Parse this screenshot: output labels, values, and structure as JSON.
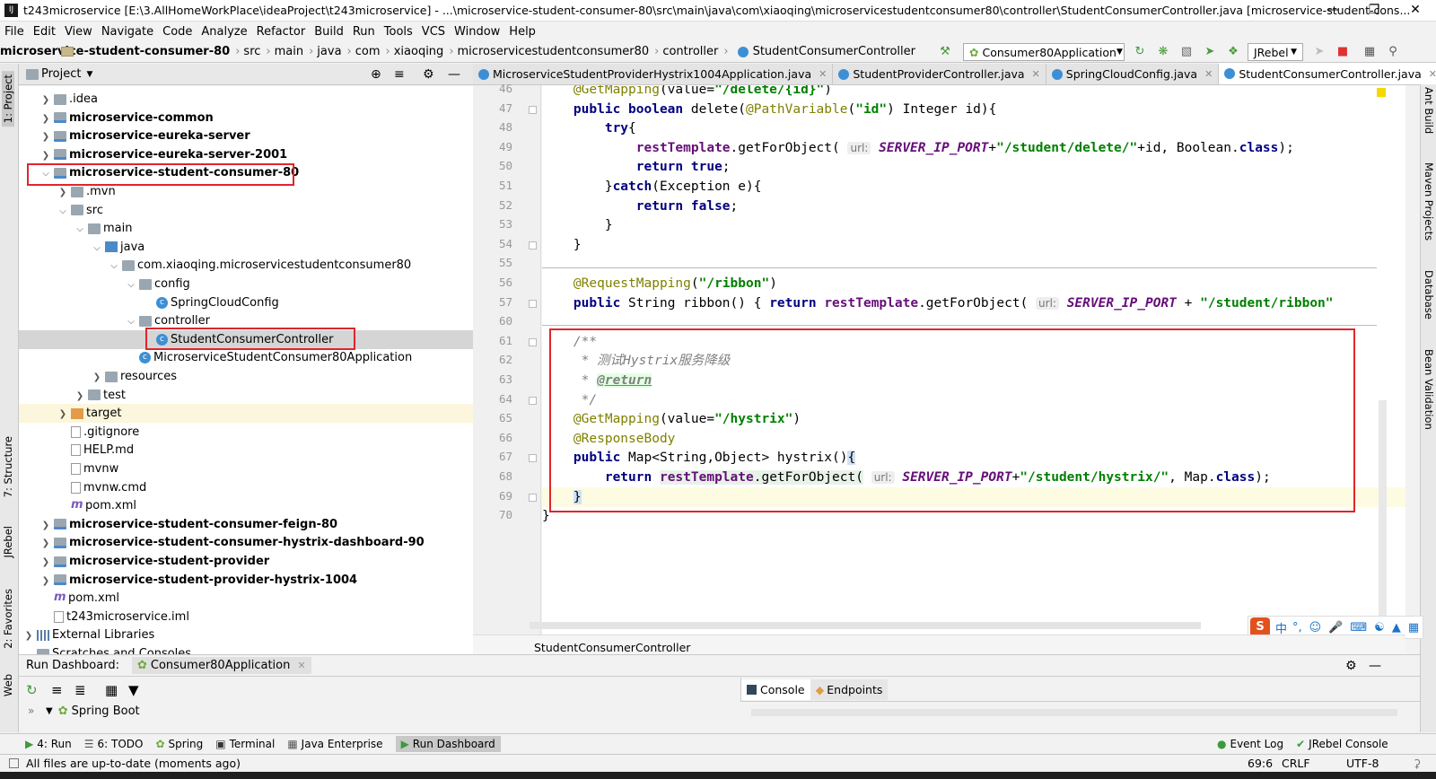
{
  "window": {
    "title": "t243microservice [E:\\3.AllHomeWorkPlace\\ideaProject\\t243microservice] - ...\\microservice-student-consumer-80\\src\\main\\java\\com\\xiaoqing\\microservicestudentconsumer80\\controller\\StudentConsumerController.java [microservice-student-cons..."
  },
  "menu": [
    "File",
    "Edit",
    "View",
    "Navigate",
    "Code",
    "Analyze",
    "Refactor",
    "Build",
    "Run",
    "Tools",
    "VCS",
    "Window",
    "Help"
  ],
  "breadcrumbs": [
    "microservice-student-consumer-80",
    "src",
    "main",
    "java",
    "com",
    "xiaoqing",
    "microservicestudentconsumer80",
    "controller",
    "StudentConsumerController"
  ],
  "run_config": "Consumer80Application",
  "jrebel": "JRebel",
  "project_panel": {
    "title": "Project"
  },
  "tree": [
    {
      "label": ".idea",
      "depth": 1,
      "icon": "folder",
      "arrow": "right",
      "bold": false
    },
    {
      "label": "microservice-common",
      "depth": 1,
      "icon": "mod",
      "arrow": "right",
      "bold": true
    },
    {
      "label": "microservice-eureka-server",
      "depth": 1,
      "icon": "mod",
      "arrow": "right",
      "bold": true
    },
    {
      "label": "microservice-eureka-server-2001",
      "depth": 1,
      "icon": "mod",
      "arrow": "right",
      "bold": true
    },
    {
      "label": "microservice-student-consumer-80",
      "depth": 1,
      "icon": "mod",
      "arrow": "down",
      "bold": true
    },
    {
      "label": ".mvn",
      "depth": 2,
      "icon": "folder",
      "arrow": "right",
      "bold": false
    },
    {
      "label": "src",
      "depth": 2,
      "icon": "folder",
      "arrow": "down",
      "bold": false
    },
    {
      "label": "main",
      "depth": 3,
      "icon": "folder",
      "arrow": "down",
      "bold": false
    },
    {
      "label": "java",
      "depth": 4,
      "icon": "src",
      "arrow": "down",
      "bold": false
    },
    {
      "label": "com.xiaoqing.microservicestudentconsumer80",
      "depth": 5,
      "icon": "folder",
      "arrow": "down",
      "bold": false
    },
    {
      "label": "config",
      "depth": 6,
      "icon": "folder",
      "arrow": "down",
      "bold": false
    },
    {
      "label": "SpringCloudConfig",
      "depth": 7,
      "icon": "class",
      "arrow": "none",
      "bold": false
    },
    {
      "label": "controller",
      "depth": 6,
      "icon": "folder",
      "arrow": "down",
      "bold": false
    },
    {
      "label": "StudentConsumerController",
      "depth": 7,
      "icon": "class",
      "arrow": "none",
      "bold": false,
      "selected": true
    },
    {
      "label": "MicroserviceStudentConsumer80Application",
      "depth": 6,
      "icon": "class",
      "arrow": "none",
      "bold": false
    },
    {
      "label": "resources",
      "depth": 4,
      "icon": "folder",
      "arrow": "right",
      "bold": false
    },
    {
      "label": "test",
      "depth": 3,
      "icon": "folder",
      "arrow": "right",
      "bold": false
    },
    {
      "label": "target",
      "depth": 2,
      "icon": "orange",
      "arrow": "right",
      "bold": false,
      "highlight": true
    },
    {
      "label": ".gitignore",
      "depth": 2,
      "icon": "file",
      "arrow": "none",
      "bold": false
    },
    {
      "label": "HELP.md",
      "depth": 2,
      "icon": "file",
      "arrow": "none",
      "bold": false
    },
    {
      "label": "mvnw",
      "depth": 2,
      "icon": "file",
      "arrow": "none",
      "bold": false
    },
    {
      "label": "mvnw.cmd",
      "depth": 2,
      "icon": "file",
      "arrow": "none",
      "bold": false
    },
    {
      "label": "pom.xml",
      "depth": 2,
      "icon": "mvn",
      "arrow": "none",
      "bold": false
    },
    {
      "label": "microservice-student-consumer-feign-80",
      "depth": 1,
      "icon": "mod",
      "arrow": "right",
      "bold": true
    },
    {
      "label": "microservice-student-consumer-hystrix-dashboard-90",
      "depth": 1,
      "icon": "mod",
      "arrow": "right",
      "bold": true
    },
    {
      "label": "microservice-student-provider",
      "depth": 1,
      "icon": "mod",
      "arrow": "right",
      "bold": true
    },
    {
      "label": "microservice-student-provider-hystrix-1004",
      "depth": 1,
      "icon": "mod",
      "arrow": "right",
      "bold": true
    },
    {
      "label": "pom.xml",
      "depth": 1,
      "icon": "mvn",
      "arrow": "none",
      "bold": false
    },
    {
      "label": "t243microservice.iml",
      "depth": 1,
      "icon": "file",
      "arrow": "none",
      "bold": false
    },
    {
      "label": "External Libraries",
      "depth": 0,
      "icon": "lib",
      "arrow": "right",
      "bold": false
    },
    {
      "label": "Scratches and Consoles",
      "depth": 0,
      "icon": "folder",
      "arrow": "none",
      "bold": false
    }
  ],
  "tabs": [
    {
      "label": "MicroserviceStudentProviderHystrix1004Application.java",
      "active": false
    },
    {
      "label": "StudentProviderController.java",
      "active": false
    },
    {
      "label": "SpringCloudConfig.java",
      "active": false
    },
    {
      "label": "StudentConsumerController.java",
      "active": true
    }
  ],
  "code_lines": [
    {
      "n": "46",
      "html": "    <span class='an'>@GetMapping</span>(value=<span class='st'>\"/delete/{id}\"</span>)"
    },
    {
      "n": "47",
      "html": "    <span class='kw'>public boolean</span> delete(<span class='an'>@PathVariable</span>(<span class='st'>\"id\"</span>) Integer id){"
    },
    {
      "n": "48",
      "html": "        <span class='kw'>try</span>{"
    },
    {
      "n": "49",
      "html": "            <span class='ct' style='color:#000;font-style:normal;font-weight:normal'><span style='color:#660e7a;font-weight:bold'>restTemplate</span></span>.getForObject( <span class='hint'>url:</span> <span class='ct'>SERVER_IP_PORT</span>+<span class='st'>\"/student/delete/\"</span>+id, Boolean.<span class='kw'>class</span>);"
    },
    {
      "n": "50",
      "html": "            <span class='kw'>return true</span>;"
    },
    {
      "n": "51",
      "html": "        }<span class='kw'>catch</span>(Exception e){"
    },
    {
      "n": "52",
      "html": "            <span class='kw'>return false</span>;"
    },
    {
      "n": "53",
      "html": "        }"
    },
    {
      "n": "54",
      "html": "    }"
    },
    {
      "n": "55",
      "html": ""
    },
    {
      "n": "56",
      "html": "    <span class='an'>@RequestMapping</span>(<span class='st'>\"/ribbon\"</span>)"
    },
    {
      "n": "57",
      "html": "    <span class='kw'>public</span> String ribbon() { <span class='kw'>return</span> <span style='color:#660e7a;font-weight:bold'>restTemplate</span>.getForObject( <span class='hint'>url:</span> <span class='ct'>SERVER_IP_PORT</span> + <span class='st'>\"/student/ribbon\"</span>"
    },
    {
      "n": "60",
      "html": ""
    },
    {
      "n": "61",
      "html": "    <span class='cm'>/**</span>"
    },
    {
      "n": "62",
      "html": "<span class='cm'>     * 测试Hystrix服务降级</span>"
    },
    {
      "n": "63",
      "html": "<span class='cm'>     * </span><span class='tag'>@return</span>"
    },
    {
      "n": "64",
      "html": "<span class='cm'>     */</span>"
    },
    {
      "n": "65",
      "html": "    <span class='an'>@GetMapping</span>(value=<span class='st'>\"/hystrix\"</span>)"
    },
    {
      "n": "66",
      "html": "    <span class='an'>@ResponseBody</span>"
    },
    {
      "n": "67",
      "html": "    <span class='kw'>public</span> Map&lt;String,Object&gt; hystrix()<span style='background:#cfe1f5'>{</span>"
    },
    {
      "n": "68",
      "html": "        <span class='kw'>return</span> <span style='background:#e8f2e8'><span style='color:#660e7a;font-weight:bold'>restTemplate</span>.getForObject(</span> <span class='hint'>url:</span> <span class='ct'>SERVER_IP_PORT</span>+<span class='st'>\"/student/hystrix/\"</span>, Map.<span class='kw'>class</span>);"
    },
    {
      "n": "69",
      "html": "    <span style='background:#cfe1f5'>}</span>"
    },
    {
      "n": "70",
      "html": "}"
    }
  ],
  "editor_crumb": "StudentConsumerController",
  "run_dashboard": {
    "title": "Run Dashboard:",
    "config": "Consumer80Application",
    "group": "Spring Boot",
    "console_tab": "Console",
    "endpoints_tab": "Endpoints"
  },
  "bottom_tabs": [
    "4: Run",
    "6: TODO",
    "Spring",
    "Terminal",
    "Java Enterprise",
    "Run Dashboard"
  ],
  "bottom_right": [
    "Event Log",
    "JRebel Console"
  ],
  "status": {
    "message": "All files are up-to-date (moments ago)",
    "position": "69:6",
    "line_sep": "CRLF",
    "encoding": "UTF-8"
  },
  "left_tools": [
    "1: Project",
    "7: Structure",
    "JRebel",
    "2: Favorites",
    "Web"
  ],
  "right_tools": [
    "Ant Build",
    "Maven Projects",
    "Database",
    "Bean Validation"
  ],
  "ime": "中"
}
